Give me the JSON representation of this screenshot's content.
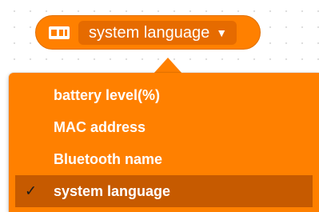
{
  "block": {
    "icon": "device-info-icon",
    "selected_value": "system language",
    "caret": "▼",
    "color": "#ff8000",
    "field_color": "#e66b00"
  },
  "menu": {
    "check_mark": "✓",
    "selected_index": 3,
    "items": [
      {
        "label": "battery level(%)"
      },
      {
        "label": "MAC address"
      },
      {
        "label": "Bluetooth name"
      },
      {
        "label": "system language"
      }
    ],
    "color": "#ff8000",
    "highlight_color": "#c65a00"
  }
}
